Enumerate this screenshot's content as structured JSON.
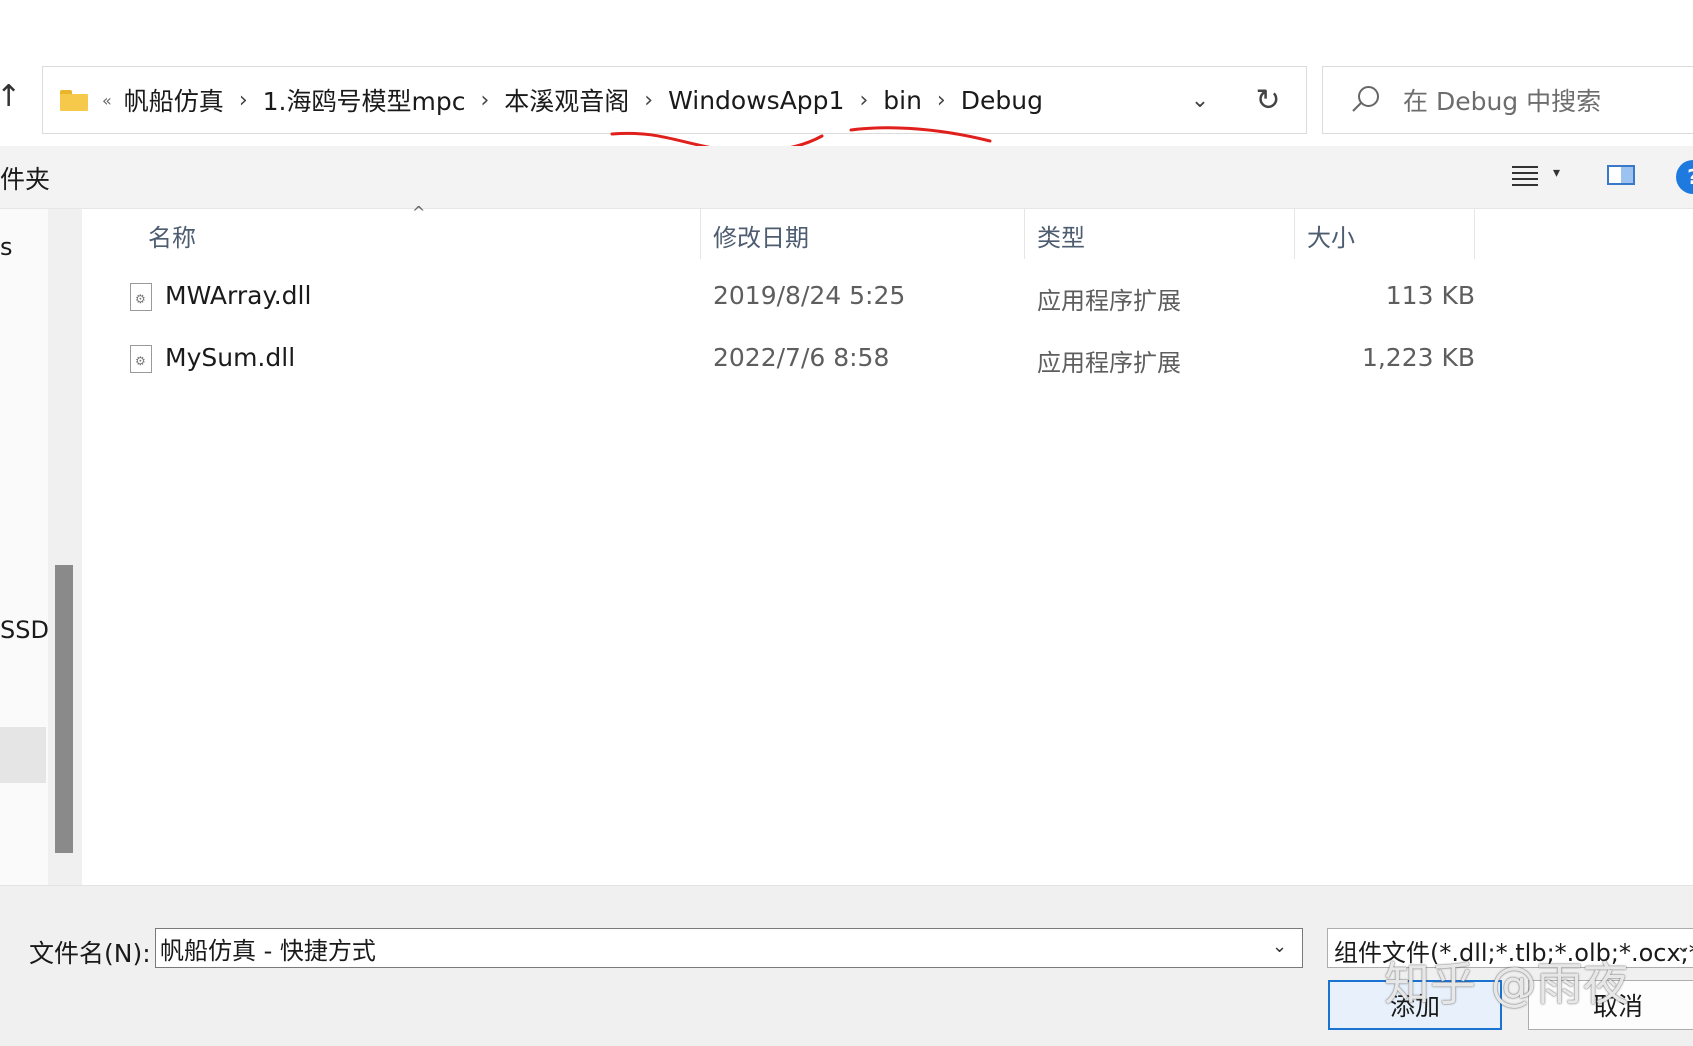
{
  "address_bar": {
    "overflow": "«",
    "breadcrumbs": [
      "帆船仿真",
      "1.海鸥号模型mpc",
      "本溪观音阁",
      "WindowsApp1",
      "bin",
      "Debug"
    ],
    "separator": "›"
  },
  "search": {
    "placeholder": "在 Debug 中搜索"
  },
  "toolbar": {
    "new_folder_label": "件夹"
  },
  "nav": {
    "item_partial": "s",
    "drive_partial": "SSD"
  },
  "columns": {
    "name": "名称",
    "date": "修改日期",
    "type": "类型",
    "size": "大小"
  },
  "files": [
    {
      "name": "MWArray.dll",
      "date": "2019/8/24 5:25",
      "type": "应用程序扩展",
      "size": "113 KB"
    },
    {
      "name": "MySum.dll",
      "date": "2022/7/6 8:58",
      "type": "应用程序扩展",
      "size": "1,223 KB"
    }
  ],
  "bottom": {
    "filename_label": "文件名(N):",
    "filename_value": "帆船仿真 - 快捷方式",
    "filter_value": "组件文件(*.dll;*.tlb;*.olb;*.ocx;*",
    "add_button": "添加",
    "cancel_button": "取消"
  },
  "watermark": "知乎 @雨夜",
  "colors": {
    "accent": "#1a73d1",
    "annotation": "#e0201c",
    "folder": "#f6c94a"
  }
}
